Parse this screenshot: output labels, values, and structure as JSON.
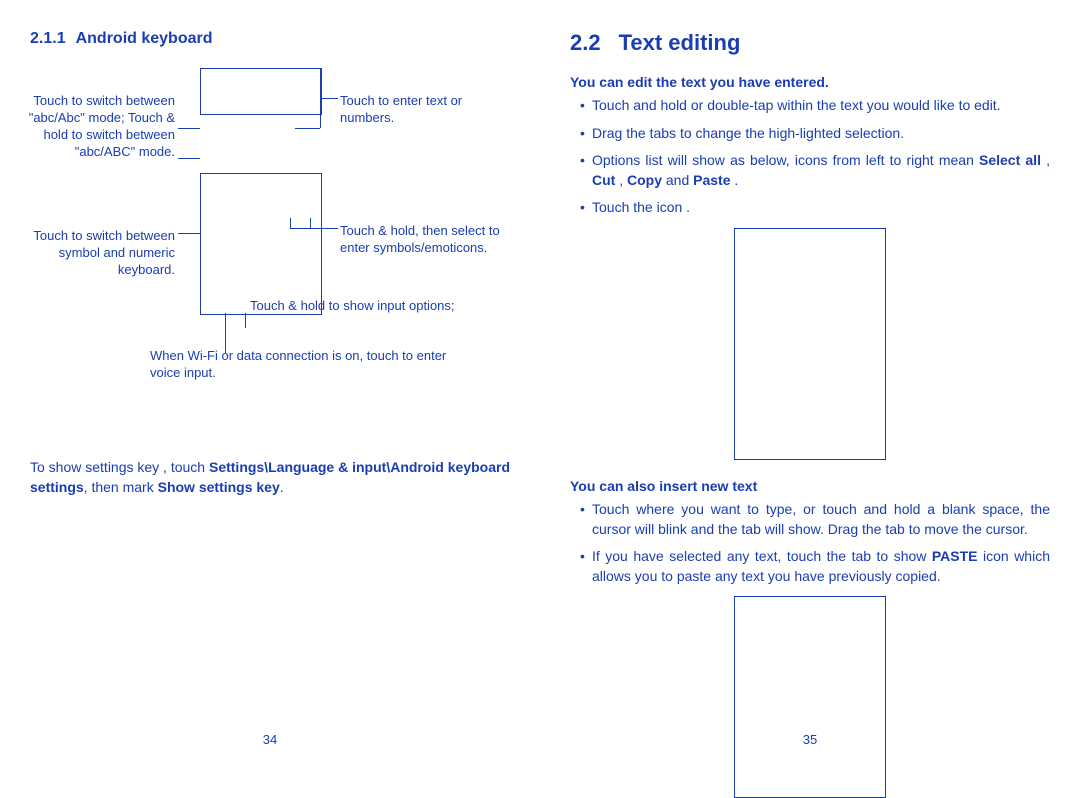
{
  "left": {
    "heading_num": "2.1.1",
    "heading_text": "Android keyboard",
    "callouts": {
      "c1": "Touch to switch between \"abc/Abc\" mode; Touch & hold to switch between \"abc/ABC\" mode.",
      "c2": "Touch to enter text or numbers.",
      "c3": "Touch to switch between symbol and numeric keyboard.",
      "c4": "Touch & hold, then select to enter symbols/emoticons.",
      "c5": "Touch & hold to show input options;",
      "c6": "When Wi-Fi or data connection is on, touch to enter voice input."
    },
    "note_a": "To show settings key      , touch ",
    "note_b": "Settings\\Language & input\\Android keyboard settings",
    "note_c": ", then mark ",
    "note_d": "Show settings key",
    "note_e": ".",
    "pagenum": "34"
  },
  "right": {
    "heading_num": "2.2",
    "heading_text": "Text editing",
    "sub1": "You can edit the text you have entered.",
    "b1": "Touch and hold or double-tap within the text you would like to edit.",
    "b2": "Drag the tabs to change the high-lighted selection.",
    "b3a": "Options list will show as below, icons from left to right mean ",
    "b3_selectall": "Select all",
    "b3_sep1": "     , ",
    "b3_cut": "Cut",
    "b3_sep2": "     , ",
    "b3_copy": "Copy",
    "b3_sep3": "      and ",
    "b3_paste": "Paste",
    "b3_end": "     .",
    "b4": "Touch the icon      .",
    "sub2": "You can also insert new text",
    "b5": "Touch where you want to type, or touch and hold a blank space, the cursor will blink and the tab will show. Drag the tab to move the cursor.",
    "b6a": "If you have selected any text, touch the tab to show ",
    "b6_paste": "PASTE",
    "b6b": " icon which allows you to paste any text you have previously copied.",
    "pagenum": "35"
  }
}
